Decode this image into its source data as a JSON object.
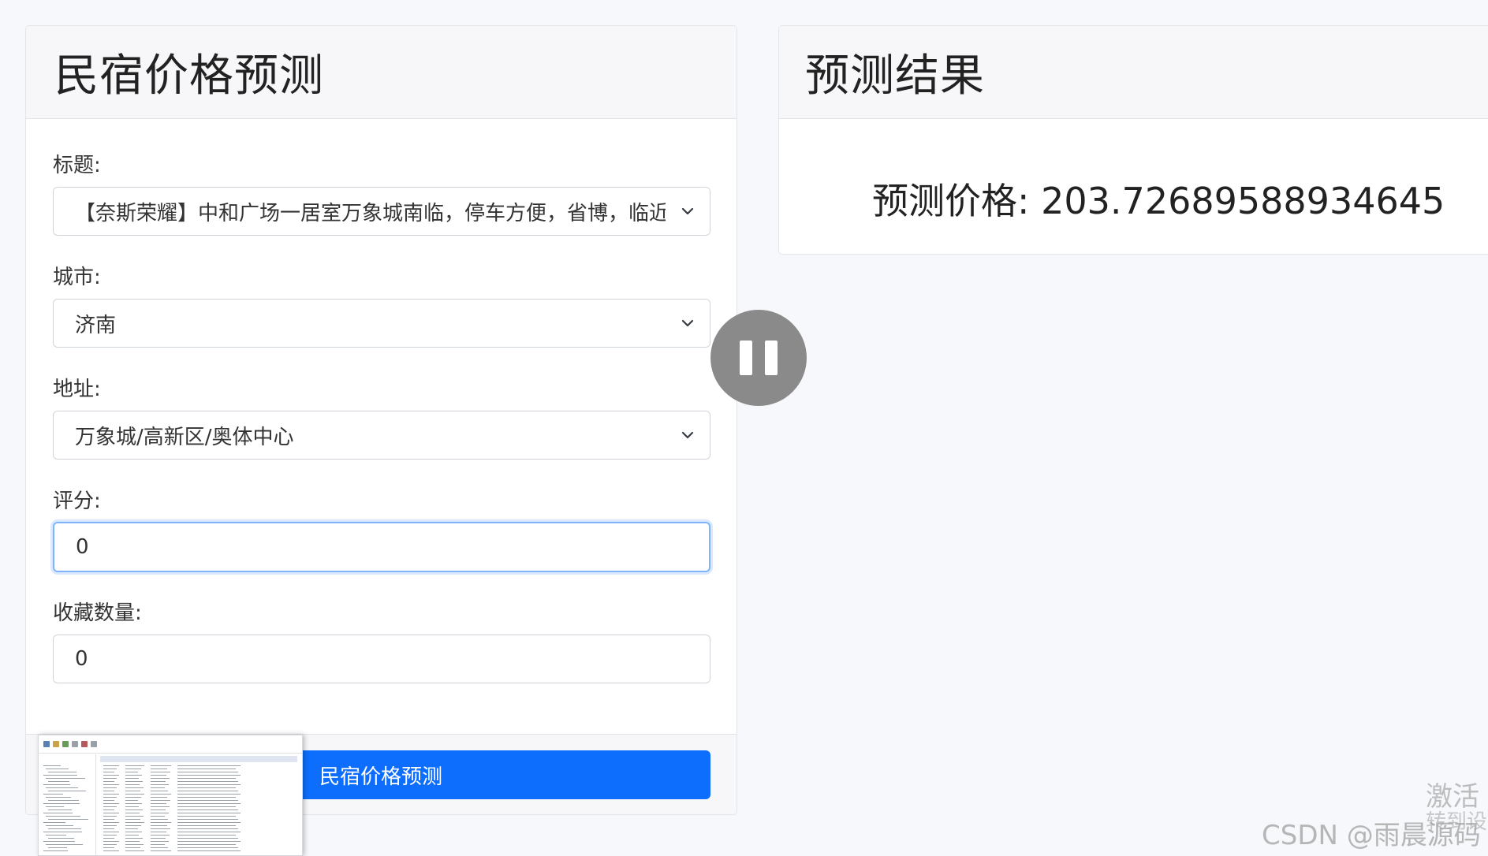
{
  "form_card": {
    "title": "民宿价格预测",
    "fields": [
      {
        "label": "标题:",
        "value": "【奈斯荣耀】中和广场一居室万象城南临，停车方便，省博，临近",
        "type": "select"
      },
      {
        "label": "城市:",
        "value": "济南",
        "type": "select"
      },
      {
        "label": "地址:",
        "value": "万象城/高新区/奥体中心",
        "type": "select"
      },
      {
        "label": "评分:",
        "value": "0",
        "type": "input"
      },
      {
        "label": "收藏数量:",
        "value": "0",
        "type": "input"
      }
    ],
    "submit_label": "民宿价格预测"
  },
  "result_card": {
    "title": "预测结果",
    "result_label": "预测价格: ",
    "result_value": "203.72689588934645"
  },
  "overlays": {
    "pause_icon": "pause-icon",
    "thumbnail": "video-thumbnail-preview"
  },
  "watermarks": {
    "activate": "激活",
    "activate_sub": "转到设",
    "csdn": "CSDN @雨晨源码"
  },
  "colors": {
    "primary": "#0d6efd",
    "focus_border": "#7fb4fa",
    "card_header_bg": "#f7f7f9",
    "page_bg": "#f7f8fb"
  }
}
